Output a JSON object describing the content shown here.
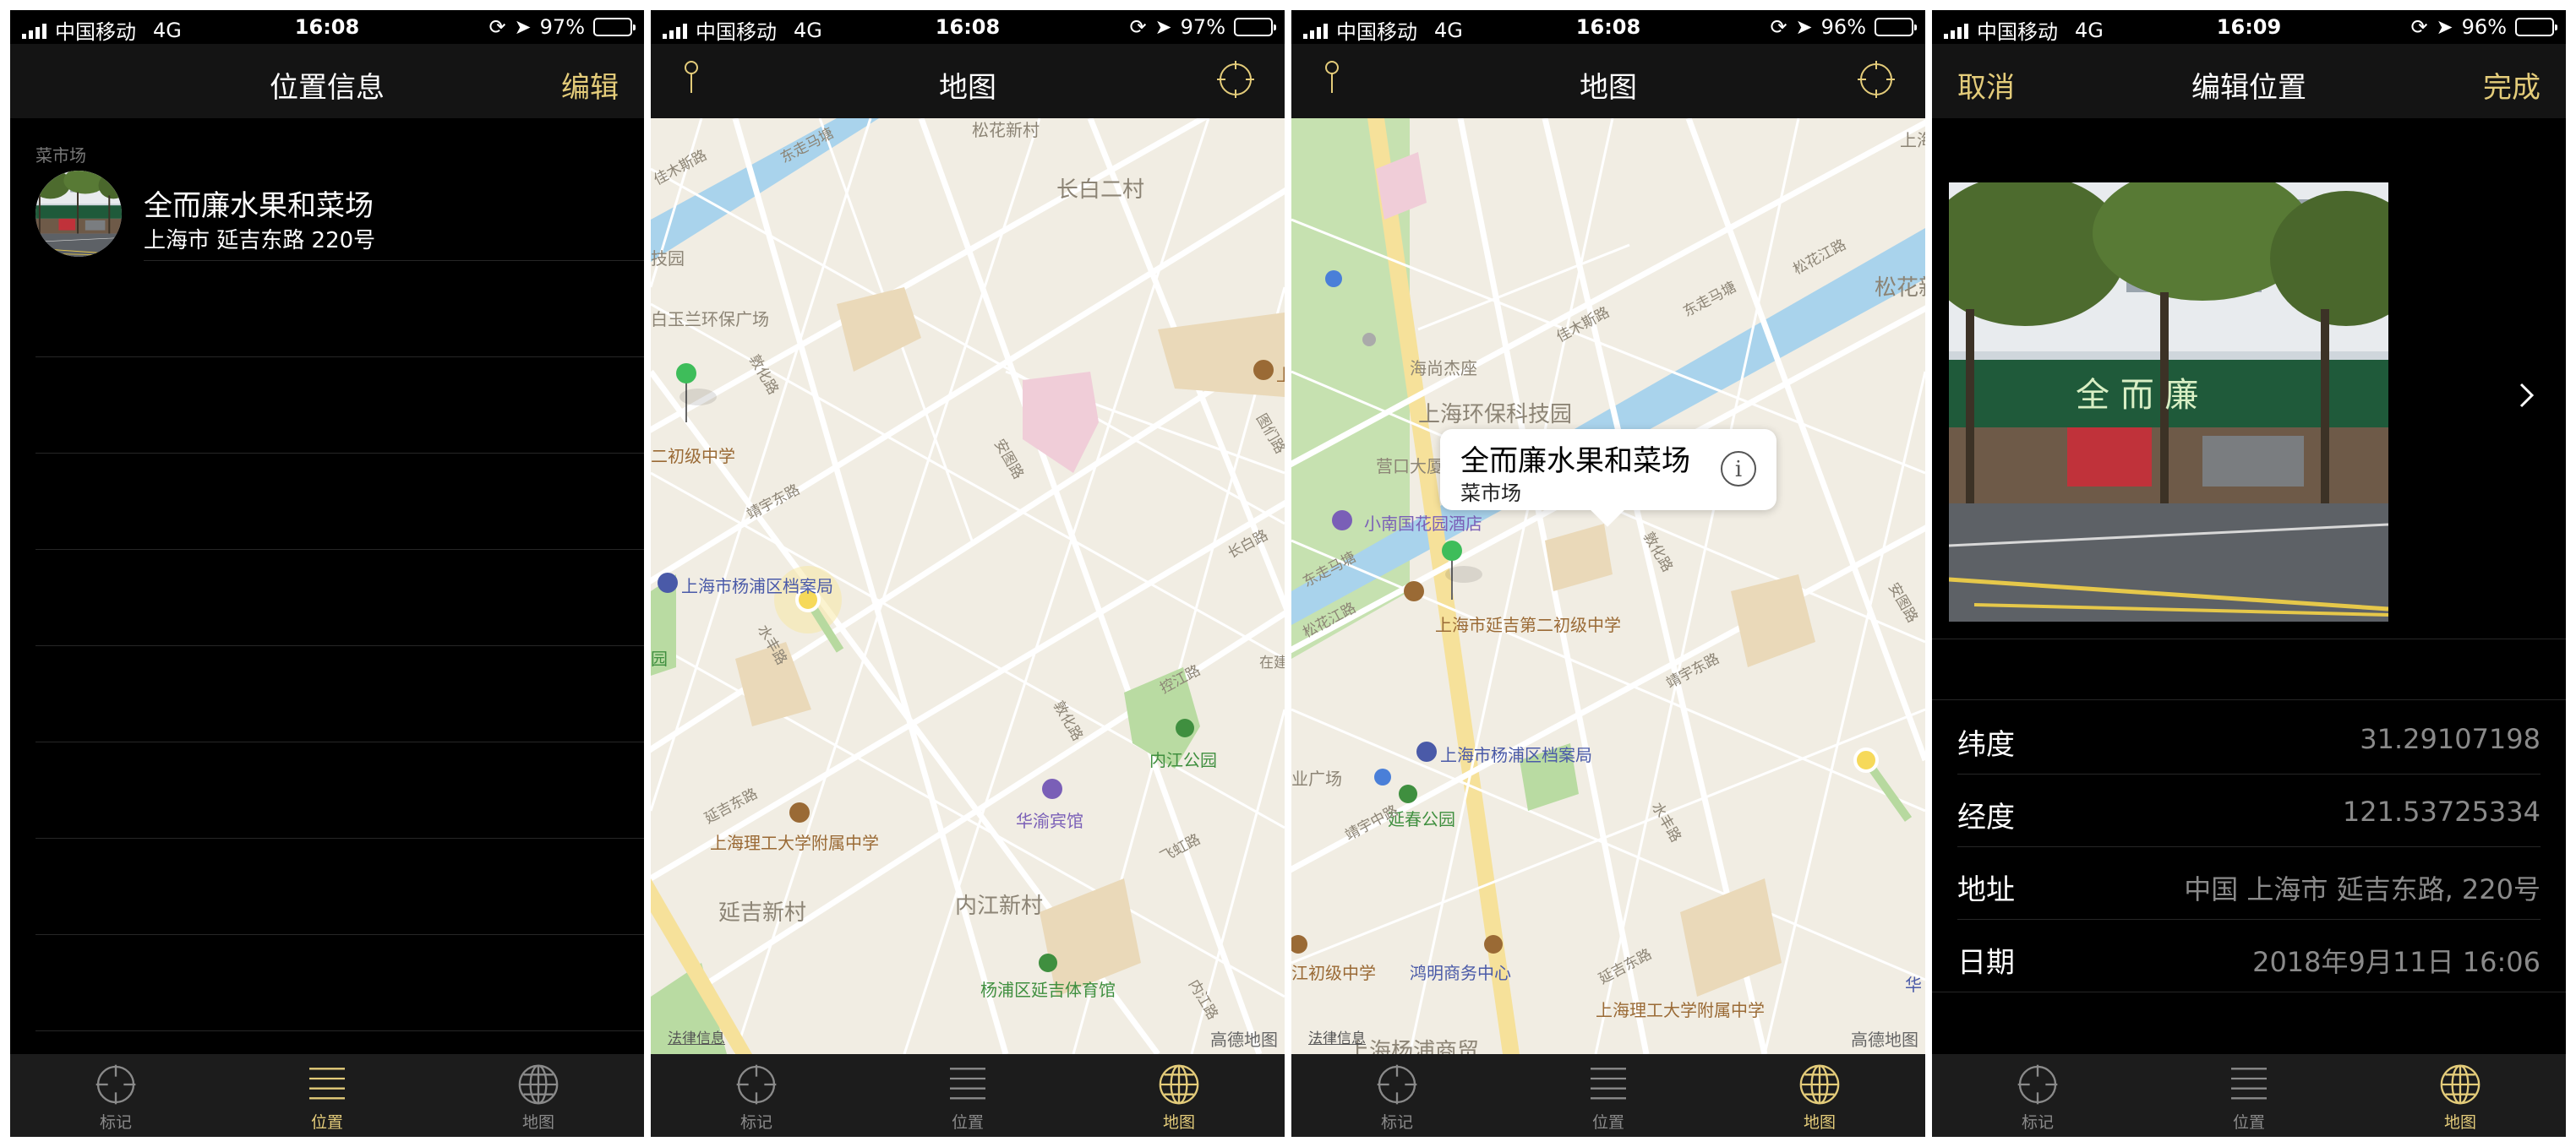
{
  "status_bars": [
    {
      "carrier": "中国移动",
      "network": "4G",
      "time": "16:08",
      "battery": "97%",
      "battery_level": 0.97
    },
    {
      "carrier": "中国移动",
      "network": "4G",
      "time": "16:08",
      "battery": "97%",
      "battery_level": 0.97
    },
    {
      "carrier": "中国移动",
      "network": "4G",
      "time": "16:08",
      "battery": "96%",
      "battery_level": 0.96
    },
    {
      "carrier": "中国移动",
      "network": "4G",
      "time": "16:09",
      "battery": "96%",
      "battery_level": 0.96
    }
  ],
  "tabs": {
    "mark": "标记",
    "location": "位置",
    "map": "地图"
  },
  "screen1": {
    "title": "位置信息",
    "edit": "编辑",
    "section": "菜市场",
    "item_name": "全而廉水果和菜场",
    "item_address": "上海市 延吉东路 220号"
  },
  "screen2": {
    "title": "地图",
    "labels": {
      "songhua": "松花新村",
      "changbai": "长白二村",
      "jiaoyuan": "技园",
      "baiyulan": "白玉兰环保广场",
      "dunhua1": "敦化路",
      "anshan": "安图路",
      "erchu": "二初级中学",
      "jingyu": "靖宇东路",
      "tumen": "图们路",
      "changbailu": "长白路",
      "dangan": "上海市杨浦区档案局",
      "shuifeng": "水丰路",
      "yuan": "园",
      "kongjiang": "控江路",
      "zai": "在建",
      "dunhua2": "敦化路",
      "neijianggy": "内江公园",
      "yanji": "延吉东路",
      "ligong": "上海理工大学附属中学",
      "huayu": "华渝宾馆",
      "feihong": "飞虹路",
      "yanjixc": "延吉新村",
      "neijiangxc": "内江新村",
      "tiyuguan": "杨浦区延吉体育馆",
      "neijianglu": "内江路",
      "shang": "上",
      "dongzhu": "东走马塘",
      "jiamusi": "佳木斯路",
      "legal": "法律信息",
      "gaode": "高德地图"
    }
  },
  "screen3": {
    "title": "地图",
    "callout_title": "全而廉水果和菜场",
    "callout_sub": "菜市场",
    "callout_info": "i",
    "labels": {
      "haishang": "海尚杰座",
      "huanbao": "上海环保科技园",
      "yingkou": "营口大厦",
      "xiaonan": "小南国花园酒店",
      "dongzm": "东走马塘",
      "dongzm2": "东走马塘",
      "jiamusi": "佳木斯路",
      "songhua": "松花江路",
      "songhuaxin": "松花新",
      "songhuajiang2": "松花江路",
      "yanjier": "上海市延吉第二初级中学",
      "dunhua": "敦化路",
      "jingyu": "靖宇东路",
      "anshan": "安图路",
      "dangan": "上海市杨浦区档案局",
      "yeguangchang": "业广场",
      "yanchun": "延春公园",
      "shuifeng": "水丰路",
      "jingyuzhong": "靖宇中路",
      "jiangchuji": "江初级中学",
      "hongming": "鸿明商务中心",
      "yanjidong": "延吉东路",
      "ligong": "上海理工大学附属中学",
      "yangpu": "上海杨浦商贸",
      "shangjiao": "上海",
      "hua": "华",
      "legal": "法律信息",
      "gaode": "高德地图"
    }
  },
  "screen4": {
    "cancel": "取消",
    "title": "编辑位置",
    "done": "完成",
    "shop_sign": "全 而 廉",
    "rows": [
      {
        "key": "纬度",
        "value": "31.29107198"
      },
      {
        "key": "经度",
        "value": "121.53725334"
      },
      {
        "key": "地址",
        "value": "中国 上海市 延吉东路, 220号"
      },
      {
        "key": "日期",
        "value": "2018年9月11日 16:06"
      }
    ]
  },
  "colors": {
    "accent": "#e4cc7a",
    "navbar": "#141414",
    "tabbar": "#1c1c1c",
    "map_bg": "#f1ede3",
    "river": "#a9d3ec",
    "park": "#b9dba2",
    "pin": "#3ebd5a"
  }
}
